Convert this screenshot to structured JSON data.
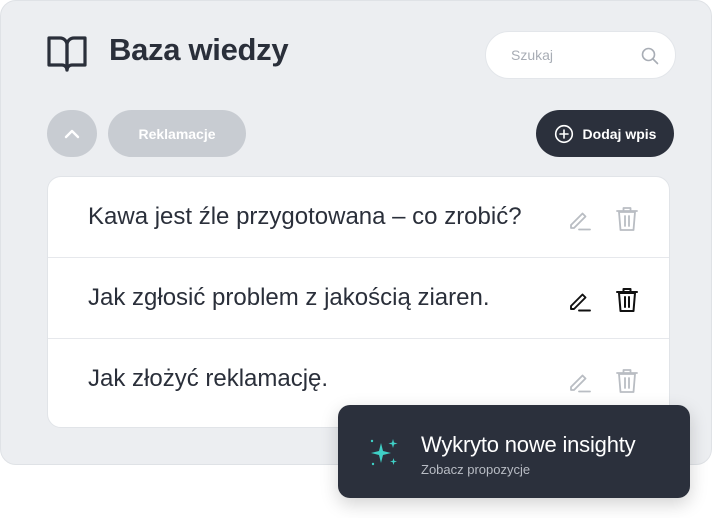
{
  "header": {
    "title": "Baza wiedzy",
    "icon": "book-icon"
  },
  "search": {
    "placeholder": "Szukaj",
    "icon": "search-icon"
  },
  "toolbar": {
    "collapse_icon": "chevron-up-icon",
    "category_label": "Reklamacje",
    "add_label": "Dodaj wpis",
    "add_icon": "plus-circle-icon"
  },
  "entries": [
    {
      "text": "Kawa jest źle przygotowana – co zrobić?",
      "state": "muted"
    },
    {
      "text": "Jak zgłosić problem z jakością ziaren.",
      "state": "active"
    },
    {
      "text": "Jak złożyć reklamację.",
      "state": "muted"
    }
  ],
  "toast": {
    "title": "Wykryto nowe insighty",
    "subtitle": "Zobacz propozycje",
    "icon": "sparkles-icon"
  },
  "colors": {
    "accent_dark": "#2b303c",
    "sparkle": "#3fd0c6",
    "muted_icon": "#b9bdc3",
    "active_icon": "#111111",
    "chip_bg": "#c8ccd2"
  }
}
